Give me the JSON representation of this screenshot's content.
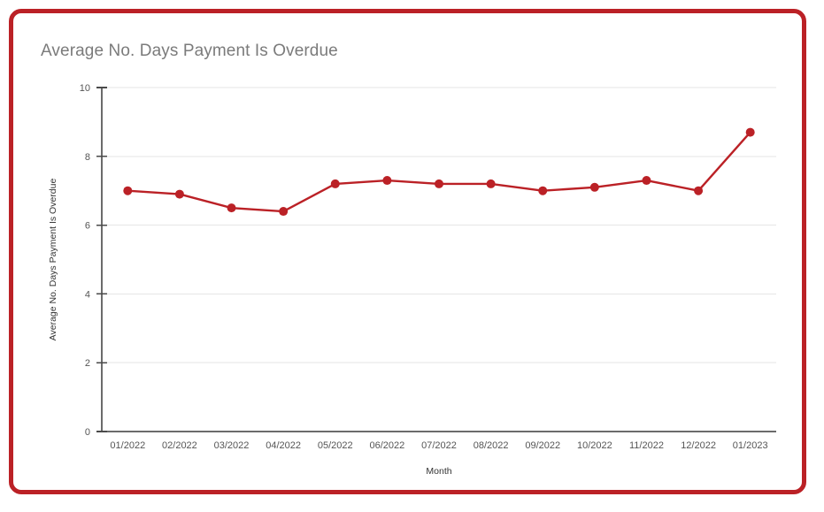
{
  "card": {
    "border_color": "#bb2126"
  },
  "chart_data": {
    "type": "line",
    "title": "Average No. Days Payment Is Overdue",
    "xlabel": "Month",
    "ylabel": "Average No. Days Payment Is Overdue",
    "categories": [
      "01/2022",
      "02/2022",
      "03/2022",
      "04/2022",
      "05/2022",
      "06/2022",
      "07/2022",
      "08/2022",
      "09/2022",
      "10/2022",
      "11/2022",
      "12/2022",
      "01/2023"
    ],
    "values": [
      7.0,
      6.9,
      6.5,
      6.4,
      7.2,
      7.3,
      7.2,
      7.2,
      7.0,
      7.1,
      7.3,
      7.0,
      8.7
    ],
    "ylim": [
      0,
      10
    ],
    "y_ticks": [
      0,
      2,
      4,
      6,
      8,
      10
    ],
    "y_tick_labels": [
      "0",
      "2",
      "4",
      "6",
      "8",
      "10"
    ],
    "grid": true,
    "legend": "none",
    "series_color": "#bb2126",
    "marker": "circle",
    "marker_size": 5
  }
}
